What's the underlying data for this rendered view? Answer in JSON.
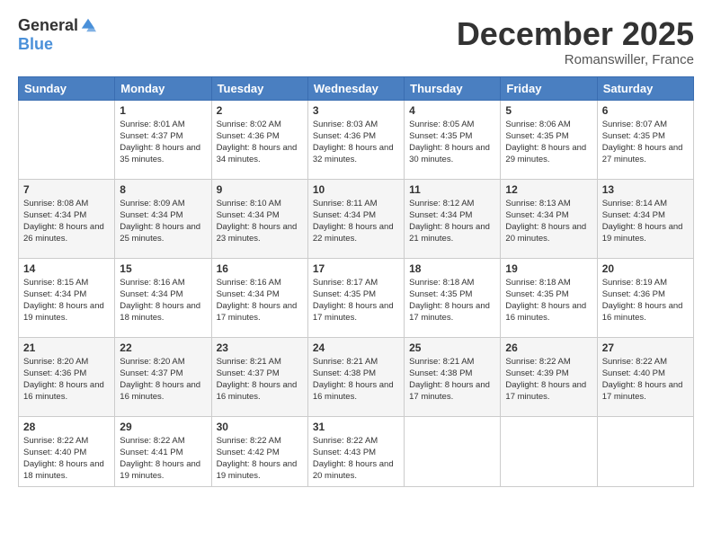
{
  "header": {
    "logo": {
      "general": "General",
      "blue": "Blue"
    },
    "title": "December 2025",
    "location": "Romanswiller, France"
  },
  "calendar": {
    "days_of_week": [
      "Sunday",
      "Monday",
      "Tuesday",
      "Wednesday",
      "Thursday",
      "Friday",
      "Saturday"
    ],
    "weeks": [
      [
        {
          "day": "",
          "sunrise": "",
          "sunset": "",
          "daylight": ""
        },
        {
          "day": "1",
          "sunrise": "Sunrise: 8:01 AM",
          "sunset": "Sunset: 4:37 PM",
          "daylight": "Daylight: 8 hours and 35 minutes."
        },
        {
          "day": "2",
          "sunrise": "Sunrise: 8:02 AM",
          "sunset": "Sunset: 4:36 PM",
          "daylight": "Daylight: 8 hours and 34 minutes."
        },
        {
          "day": "3",
          "sunrise": "Sunrise: 8:03 AM",
          "sunset": "Sunset: 4:36 PM",
          "daylight": "Daylight: 8 hours and 32 minutes."
        },
        {
          "day": "4",
          "sunrise": "Sunrise: 8:05 AM",
          "sunset": "Sunset: 4:35 PM",
          "daylight": "Daylight: 8 hours and 30 minutes."
        },
        {
          "day": "5",
          "sunrise": "Sunrise: 8:06 AM",
          "sunset": "Sunset: 4:35 PM",
          "daylight": "Daylight: 8 hours and 29 minutes."
        },
        {
          "day": "6",
          "sunrise": "Sunrise: 8:07 AM",
          "sunset": "Sunset: 4:35 PM",
          "daylight": "Daylight: 8 hours and 27 minutes."
        }
      ],
      [
        {
          "day": "7",
          "sunrise": "Sunrise: 8:08 AM",
          "sunset": "Sunset: 4:34 PM",
          "daylight": "Daylight: 8 hours and 26 minutes."
        },
        {
          "day": "8",
          "sunrise": "Sunrise: 8:09 AM",
          "sunset": "Sunset: 4:34 PM",
          "daylight": "Daylight: 8 hours and 25 minutes."
        },
        {
          "day": "9",
          "sunrise": "Sunrise: 8:10 AM",
          "sunset": "Sunset: 4:34 PM",
          "daylight": "Daylight: 8 hours and 23 minutes."
        },
        {
          "day": "10",
          "sunrise": "Sunrise: 8:11 AM",
          "sunset": "Sunset: 4:34 PM",
          "daylight": "Daylight: 8 hours and 22 minutes."
        },
        {
          "day": "11",
          "sunrise": "Sunrise: 8:12 AM",
          "sunset": "Sunset: 4:34 PM",
          "daylight": "Daylight: 8 hours and 21 minutes."
        },
        {
          "day": "12",
          "sunrise": "Sunrise: 8:13 AM",
          "sunset": "Sunset: 4:34 PM",
          "daylight": "Daylight: 8 hours and 20 minutes."
        },
        {
          "day": "13",
          "sunrise": "Sunrise: 8:14 AM",
          "sunset": "Sunset: 4:34 PM",
          "daylight": "Daylight: 8 hours and 19 minutes."
        }
      ],
      [
        {
          "day": "14",
          "sunrise": "Sunrise: 8:15 AM",
          "sunset": "Sunset: 4:34 PM",
          "daylight": "Daylight: 8 hours and 19 minutes."
        },
        {
          "day": "15",
          "sunrise": "Sunrise: 8:16 AM",
          "sunset": "Sunset: 4:34 PM",
          "daylight": "Daylight: 8 hours and 18 minutes."
        },
        {
          "day": "16",
          "sunrise": "Sunrise: 8:16 AM",
          "sunset": "Sunset: 4:34 PM",
          "daylight": "Daylight: 8 hours and 17 minutes."
        },
        {
          "day": "17",
          "sunrise": "Sunrise: 8:17 AM",
          "sunset": "Sunset: 4:35 PM",
          "daylight": "Daylight: 8 hours and 17 minutes."
        },
        {
          "day": "18",
          "sunrise": "Sunrise: 8:18 AM",
          "sunset": "Sunset: 4:35 PM",
          "daylight": "Daylight: 8 hours and 17 minutes."
        },
        {
          "day": "19",
          "sunrise": "Sunrise: 8:18 AM",
          "sunset": "Sunset: 4:35 PM",
          "daylight": "Daylight: 8 hours and 16 minutes."
        },
        {
          "day": "20",
          "sunrise": "Sunrise: 8:19 AM",
          "sunset": "Sunset: 4:36 PM",
          "daylight": "Daylight: 8 hours and 16 minutes."
        }
      ],
      [
        {
          "day": "21",
          "sunrise": "Sunrise: 8:20 AM",
          "sunset": "Sunset: 4:36 PM",
          "daylight": "Daylight: 8 hours and 16 minutes."
        },
        {
          "day": "22",
          "sunrise": "Sunrise: 8:20 AM",
          "sunset": "Sunset: 4:37 PM",
          "daylight": "Daylight: 8 hours and 16 minutes."
        },
        {
          "day": "23",
          "sunrise": "Sunrise: 8:21 AM",
          "sunset": "Sunset: 4:37 PM",
          "daylight": "Daylight: 8 hours and 16 minutes."
        },
        {
          "day": "24",
          "sunrise": "Sunrise: 8:21 AM",
          "sunset": "Sunset: 4:38 PM",
          "daylight": "Daylight: 8 hours and 16 minutes."
        },
        {
          "day": "25",
          "sunrise": "Sunrise: 8:21 AM",
          "sunset": "Sunset: 4:38 PM",
          "daylight": "Daylight: 8 hours and 17 minutes."
        },
        {
          "day": "26",
          "sunrise": "Sunrise: 8:22 AM",
          "sunset": "Sunset: 4:39 PM",
          "daylight": "Daylight: 8 hours and 17 minutes."
        },
        {
          "day": "27",
          "sunrise": "Sunrise: 8:22 AM",
          "sunset": "Sunset: 4:40 PM",
          "daylight": "Daylight: 8 hours and 17 minutes."
        }
      ],
      [
        {
          "day": "28",
          "sunrise": "Sunrise: 8:22 AM",
          "sunset": "Sunset: 4:40 PM",
          "daylight": "Daylight: 8 hours and 18 minutes."
        },
        {
          "day": "29",
          "sunrise": "Sunrise: 8:22 AM",
          "sunset": "Sunset: 4:41 PM",
          "daylight": "Daylight: 8 hours and 19 minutes."
        },
        {
          "day": "30",
          "sunrise": "Sunrise: 8:22 AM",
          "sunset": "Sunset: 4:42 PM",
          "daylight": "Daylight: 8 hours and 19 minutes."
        },
        {
          "day": "31",
          "sunrise": "Sunrise: 8:22 AM",
          "sunset": "Sunset: 4:43 PM",
          "daylight": "Daylight: 8 hours and 20 minutes."
        },
        {
          "day": "",
          "sunrise": "",
          "sunset": "",
          "daylight": ""
        },
        {
          "day": "",
          "sunrise": "",
          "sunset": "",
          "daylight": ""
        },
        {
          "day": "",
          "sunrise": "",
          "sunset": "",
          "daylight": ""
        }
      ]
    ]
  }
}
